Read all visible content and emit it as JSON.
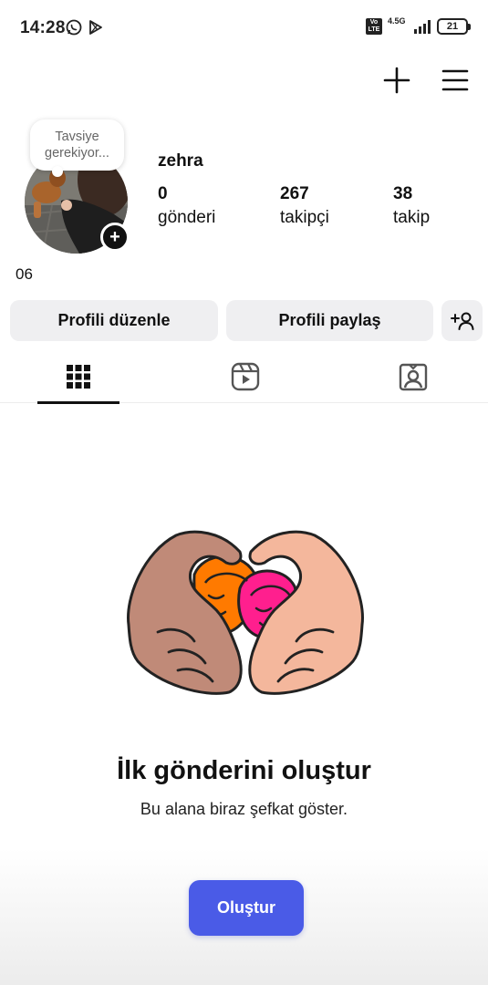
{
  "status_bar": {
    "time": "14:28",
    "volte": "Vo LTE",
    "network": "4.5G",
    "battery": "21",
    "icons": [
      "whatsapp-icon",
      "play-store-icon",
      "signal-icon",
      "battery-icon"
    ]
  },
  "header": {
    "icons": [
      "plus-icon",
      "menu-icon"
    ]
  },
  "profile": {
    "note_line1": "Tavsiye",
    "note_line2": "gerekiyor...",
    "username": "zehra",
    "stats": {
      "posts_count": "0",
      "posts_label": "gönderi",
      "followers_count": "267",
      "followers_label": "takipçi",
      "following_count": "38",
      "following_label": "takip"
    },
    "bio": "06",
    "add_story_icon": "+"
  },
  "buttons": {
    "edit_profile": "Profili düzenle",
    "share_profile": "Profili paylaş"
  },
  "tabs": {
    "icons": [
      "grid-icon",
      "reels-icon",
      "tagged-icon"
    ],
    "active": "grid"
  },
  "empty_state": {
    "title": "İlk gönderini oluştur",
    "subtitle": "Bu alana biraz şefkat göster.",
    "create_button": "Oluştur"
  },
  "colors": {
    "accent": "#4a5be7",
    "button_bg": "#efeff1",
    "hand_dark": "#c08a78",
    "hand_light": "#f4b79c",
    "face_orange": "#ff7a00",
    "face_pink": "#ff1f8e"
  }
}
